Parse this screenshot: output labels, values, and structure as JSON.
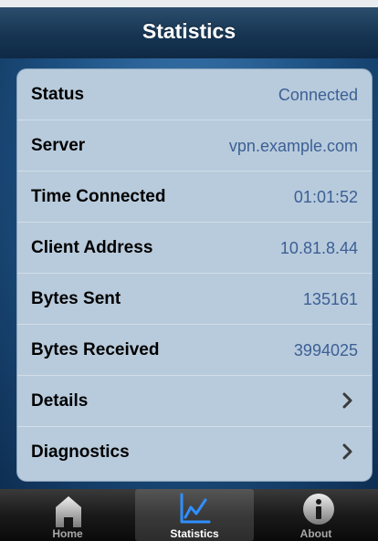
{
  "navbar": {
    "title": "Statistics"
  },
  "rows": [
    {
      "label": "Status",
      "value": "Connected"
    },
    {
      "label": "Server",
      "value": "vpn.example.com"
    },
    {
      "label": "Time Connected",
      "value": "01:01:52"
    },
    {
      "label": "Client Address",
      "value": "10.81.8.44"
    },
    {
      "label": "Bytes Sent",
      "value": "135161"
    },
    {
      "label": "Bytes Received",
      "value": "3994025"
    },
    {
      "label": "Details",
      "icon": "chevron-right-icon"
    },
    {
      "label": "Diagnostics",
      "icon": "chevron-right-icon"
    }
  ],
  "tabs": [
    {
      "label": "Home",
      "icon": "home-icon",
      "selected": false
    },
    {
      "label": "Statistics",
      "icon": "chart-icon",
      "selected": true
    },
    {
      "label": "About",
      "icon": "info-icon",
      "selected": false
    }
  ],
  "colors": {
    "value_text": "#3c5f95",
    "navbar": "#163552",
    "tab_selected_icon": "#2f8fff"
  }
}
